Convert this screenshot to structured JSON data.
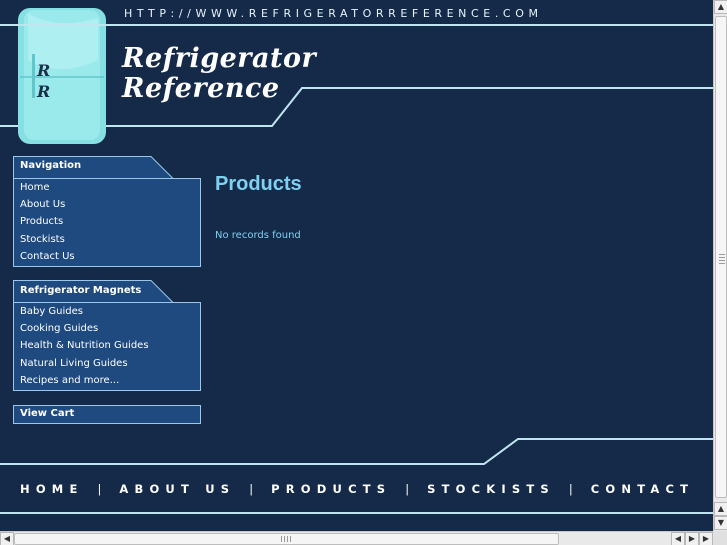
{
  "header": {
    "url": "HTTP://WWW.REFRIGERATORREFERENCE.COM",
    "logo_line1": "Refrigerator",
    "logo_line2": "Reference",
    "fridge_letter": "R"
  },
  "sidebar": {
    "navigation": {
      "title": "Navigation",
      "items": [
        {
          "label": "Home"
        },
        {
          "label": "About Us"
        },
        {
          "label": "Products"
        },
        {
          "label": "Stockists"
        },
        {
          "label": "Contact Us"
        }
      ]
    },
    "magnets": {
      "title": "Refrigerator Magnets",
      "items": [
        {
          "label": "Baby Guides"
        },
        {
          "label": "Cooking Guides"
        },
        {
          "label": "Health & Nutrition Guides"
        },
        {
          "label": "Natural Living Guides"
        },
        {
          "label": "Recipes and more..."
        }
      ]
    },
    "cart": {
      "label": "View Cart"
    }
  },
  "main": {
    "title": "Products",
    "message": "No records found"
  },
  "footer": {
    "nav": [
      {
        "label": "HOME"
      },
      {
        "label": "ABOUT US"
      },
      {
        "label": "PRODUCTS"
      },
      {
        "label": "STOCKISTS"
      },
      {
        "label": "CONTACT"
      }
    ],
    "separator": "|"
  },
  "colors": {
    "background": "#152a48",
    "box_fill": "#1f4a80",
    "accent_line": "#bfe6f0",
    "title_color": "#7fd0f0",
    "fridge": "#8fe0e4"
  }
}
